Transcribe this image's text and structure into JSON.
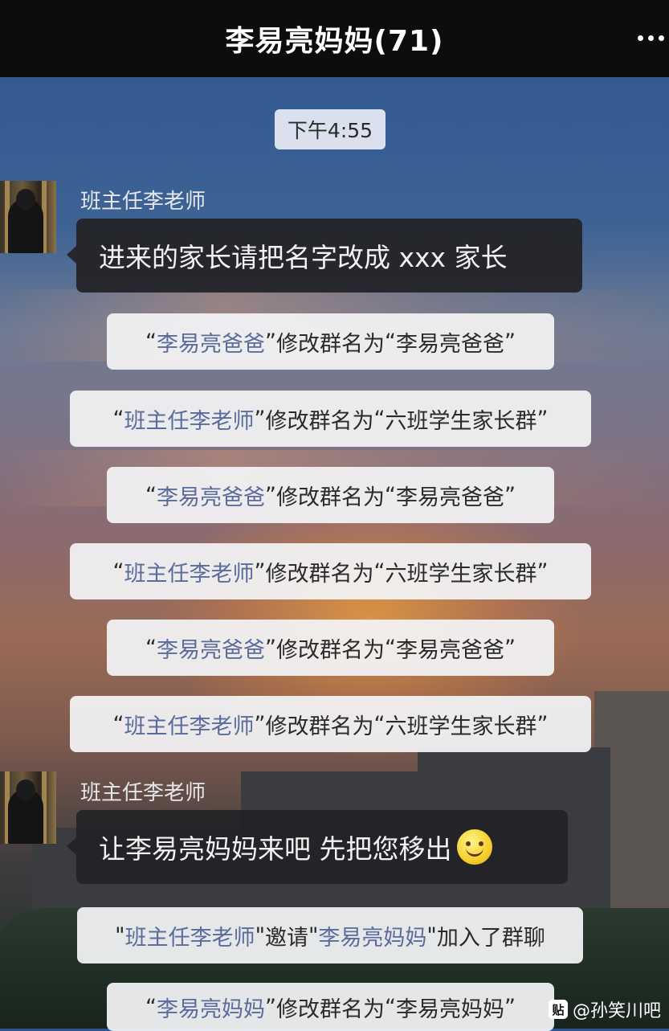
{
  "header": {
    "title": "李易亮妈妈(71)"
  },
  "time_divider": "下午4:55",
  "messages": [
    {
      "sender": "班主任李老师",
      "text": "进来的家长请把名字改成 xxx 家长"
    },
    {
      "sender": "班主任李老师",
      "text": "让李易亮妈妈来吧 先把您移出",
      "emoji": "smile-icon"
    }
  ],
  "system_notices": [
    {
      "name": "李易亮爸爸",
      "action": "修改群名为",
      "value": "李易亮爸爸"
    },
    {
      "name": "班主任李老师",
      "action": "修改群名为",
      "value": "六班学生家长群"
    },
    {
      "name": "李易亮爸爸",
      "action": "修改群名为",
      "value": "李易亮爸爸"
    },
    {
      "name": "班主任李老师",
      "action": "修改群名为",
      "value": "六班学生家长群"
    },
    {
      "name": "李易亮爸爸",
      "action": "修改群名为",
      "value": "李易亮爸爸"
    },
    {
      "name": "班主任李老师",
      "action": "修改群名为",
      "value": "六班学生家长群"
    },
    {
      "name": "班主任李老师",
      "action": "邀请",
      "value": "李易亮妈妈",
      "suffix": "加入了群聊"
    },
    {
      "name": "李易亮妈妈",
      "action": "修改群名为",
      "value": "李易亮妈妈"
    }
  ],
  "watermark": {
    "icon_text": "贴",
    "text": "@孙笑川吧"
  }
}
